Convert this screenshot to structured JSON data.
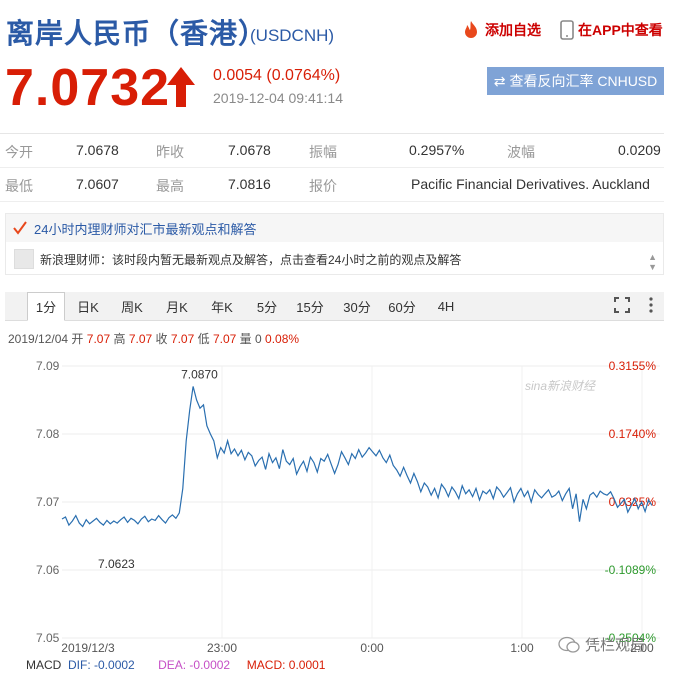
{
  "header": {
    "title": "离岸人民币（香港）",
    "symbol": "(USDCNH)",
    "add_favorite": "添加自选",
    "view_in_app": "在APP中查看"
  },
  "quote": {
    "price": "7.0732",
    "direction": "up",
    "change": "0.0054 (0.0764%)",
    "timestamp": "2019-12-04 09:41:14",
    "reverse_button": "查看反向汇率 CNHUSD",
    "up_color": "#d81e06",
    "down_color": "#2e9a2e",
    "accent_color": "#2b5aa6"
  },
  "stats": [
    [
      {
        "label": "今开",
        "value": "7.0678"
      },
      {
        "label": "昨收",
        "value": "7.0678"
      },
      {
        "label": "振幅",
        "value": "0.2957%"
      },
      {
        "label": "波幅",
        "value": "0.0209"
      }
    ],
    [
      {
        "label": "最低",
        "value": "7.0607"
      },
      {
        "label": "最高",
        "value": "7.0816"
      },
      {
        "label": "报价",
        "value": "Pacific Financial Derivatives. Auckland"
      }
    ]
  ],
  "news": {
    "heading": "24小时内理财师对汇市最新观点和解答",
    "message": "新浪理财师：该时段内暂无最新观点及解答，点击查看24小时之前的观点及解答"
  },
  "tabs": [
    "1分",
    "日K",
    "周K",
    "月K",
    "年K",
    "5分",
    "15分",
    "30分",
    "60分",
    "4H"
  ],
  "active_tab": "1分",
  "tab_icons": [
    "fullscreen-icon",
    "more-icon"
  ],
  "ohlc": {
    "date": "2019/12/04",
    "open_label": "开",
    "open": "7.07",
    "high_label": "高",
    "high": "7.07",
    "close_label": "收",
    "close": "7.07",
    "low_label": "低",
    "low": "7.07",
    "volume_label": "量",
    "volume": "0",
    "pct": "0.08%"
  },
  "chart_data": {
    "type": "line",
    "ylim": [
      7.05,
      7.09
    ],
    "y_ticks": [
      "7.09",
      "7.08",
      "7.07",
      "7.06",
      "7.05"
    ],
    "right_ticks": [
      "0.3155%",
      "0.1740%",
      "0.0325%",
      "-0.1089%",
      "-0.2504%"
    ],
    "x_ticks": [
      "2019/12/3",
      "23:00",
      "0:00",
      "1:00",
      "2:00"
    ],
    "annotations": {
      "high": "7.0870",
      "low": "7.0623"
    },
    "watermark": "sina新浪财经",
    "line_color": "#2a6fb0",
    "series": [
      {
        "values": [
          7.0675,
          7.0678,
          7.0666,
          7.0672,
          7.068,
          7.0669,
          7.0664,
          7.0674,
          7.0668,
          7.0672,
          7.0676,
          7.067,
          7.0666,
          7.0673,
          7.0668,
          7.0672,
          7.0669,
          7.0674,
          7.0678,
          7.067,
          7.0676,
          7.0673,
          7.0668,
          7.0675,
          7.0679,
          7.0671,
          7.0675,
          7.0673,
          7.068,
          7.0674,
          7.0669,
          7.0677,
          7.0681,
          7.0676,
          7.0684,
          7.072,
          7.079,
          7.0835,
          7.087,
          7.085,
          7.0838,
          7.0843,
          7.0812,
          7.08,
          7.079,
          7.0765,
          7.078,
          7.0772,
          7.079,
          7.0771,
          7.0778,
          7.0768,
          7.0776,
          7.0762,
          7.0773,
          7.0768,
          7.0753,
          7.0761,
          7.0766,
          7.0748,
          7.0771,
          7.0758,
          7.0765,
          7.0749,
          7.0777,
          7.076,
          7.0755,
          7.0764,
          7.0741,
          7.0752,
          7.076,
          7.0745,
          7.0766,
          7.0758,
          7.0744,
          7.0764,
          7.076,
          7.077,
          7.0756,
          7.0742,
          7.0755,
          7.0774,
          7.0765,
          7.0755,
          7.0771,
          7.0764,
          7.0777,
          7.0766,
          7.0772,
          7.078,
          7.0774,
          7.0768,
          7.0776,
          7.0765,
          7.0758,
          7.0769,
          7.0754,
          7.0747,
          7.0738,
          7.0751,
          7.0739,
          7.0728,
          7.0742,
          7.073,
          7.0715,
          7.0728,
          7.0722,
          7.071,
          7.072,
          7.0706,
          7.0726,
          7.0719,
          7.0708,
          7.0722,
          7.0715,
          7.0705,
          7.0724,
          7.0712,
          7.0718,
          7.0708,
          7.072,
          7.0703,
          7.0716,
          7.0712,
          7.0718,
          7.0705,
          7.0722,
          7.0716,
          7.0707,
          7.0714,
          7.0721,
          7.07,
          7.0712,
          7.072,
          7.0708,
          7.0716,
          7.07,
          7.0718,
          7.0711,
          7.0706,
          7.0712,
          7.0718,
          7.0707,
          7.071,
          7.0716,
          7.0702,
          7.0712,
          7.072,
          7.069,
          7.0712,
          7.0671,
          7.0704,
          7.069,
          7.071,
          7.0714,
          7.0707,
          7.0716,
          7.0712,
          7.071,
          7.0715,
          7.0705,
          7.0692,
          7.0698,
          7.0704,
          7.0685,
          7.0695,
          7.0705,
          7.069,
          7.07,
          7.0686,
          7.0703,
          7.0695
        ]
      }
    ]
  },
  "macd": {
    "label": "MACD",
    "dif_label": "DIF: -0.0002",
    "dea_label": "DEA: -0.0002",
    "macd_label": "MACD: 0.0001",
    "dif_color": "#2b5aa6",
    "dea_color": "#c64fc6",
    "macd_color": "#d81e06"
  },
  "watermark_account": "凭栏观局"
}
